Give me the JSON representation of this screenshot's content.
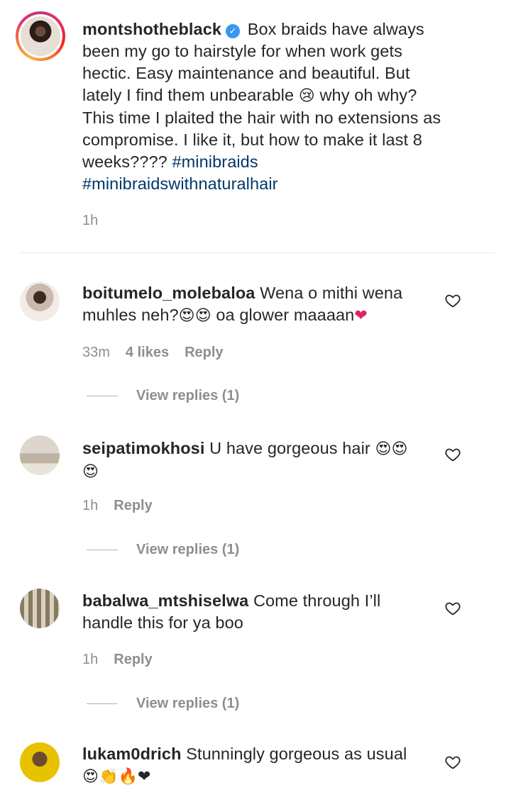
{
  "caption": {
    "username": "montshotheblack",
    "verified_mark": "✓",
    "lines": [
      "Box braids have always",
      "been my go to hairstyle for when work gets",
      "hectic. Easy maintenance and beautiful. But",
      "lately I find them unbearable",
      "why oh why?",
      "This time I plaited the hair with no extensions as",
      "compromise. I like it, but how to make it last 8",
      "weeks????"
    ],
    "emoji_sad": "😢",
    "hashtags": [
      "#minibraids",
      "#minibraidswithnaturalhair"
    ],
    "time": "1h"
  },
  "comments": [
    {
      "username": "boitumelo_molebaloa",
      "line1": "Wena o mithi wena",
      "line2": "muhles neh?",
      "emoji1": "😍😍",
      "line2b": "oa glower maaaan",
      "emoji2": "❤",
      "time": "33m",
      "likes": "4 likes",
      "reply": "Reply",
      "view_replies": "View replies (1)"
    },
    {
      "username": "seipatimokhosi",
      "line1": "U have gorgeous hair",
      "emoji1": "😍😍",
      "emoji2": "😍",
      "time": "1h",
      "reply": "Reply",
      "view_replies": "View replies (1)"
    },
    {
      "username": "babalwa_mtshiselwa",
      "line1": "Come through I’ll",
      "line2": "handle this for ya boo",
      "time": "1h",
      "reply": "Reply",
      "view_replies": "View replies (1)"
    },
    {
      "username": "lukam0drich",
      "line1": "Stunningly gorgeous as usual",
      "emoji2": "😍👏🔥❤"
    }
  ],
  "icons": {
    "heart": "heart-icon",
    "verified": "verified-badge-icon"
  },
  "colors": {
    "text": "#262626",
    "muted": "#8e8e8e",
    "hashtag": "#00376b",
    "verified": "#3897f0",
    "heart_emoji": "#e0245e"
  }
}
